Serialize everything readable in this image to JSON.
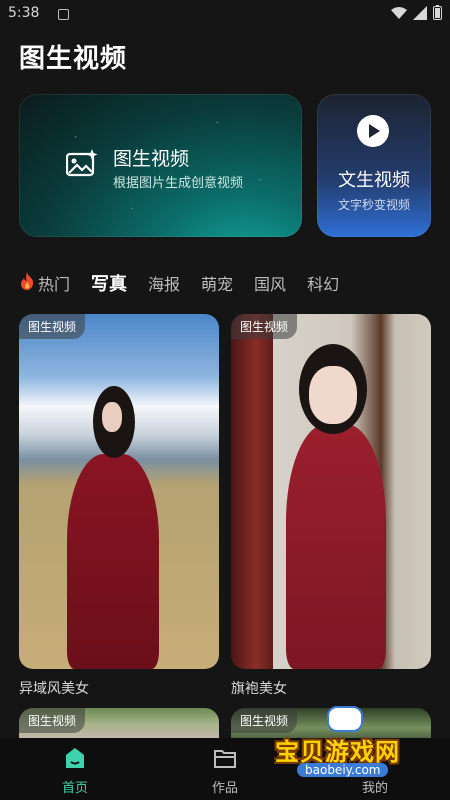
{
  "status_bar": {
    "time": "5:38"
  },
  "page_title": "图生视频",
  "card_main": {
    "title": "图生视频",
    "subtitle": "根据图片生成创意视频",
    "icon": "image-sparkle-icon"
  },
  "card_side": {
    "title": "文生视频",
    "subtitle": "文字秒变视频",
    "icon": "play-icon"
  },
  "tabs": [
    {
      "label": "热门",
      "icon": "flame-icon"
    },
    {
      "label": "写真",
      "active": true
    },
    {
      "label": "海报"
    },
    {
      "label": "萌宠"
    },
    {
      "label": "国风"
    },
    {
      "label": "科幻"
    }
  ],
  "tiles": [
    {
      "tag": "图生视频",
      "caption": "异域风美女"
    },
    {
      "tag": "图生视频",
      "caption": "旗袍美女"
    },
    {
      "tag": "图生视频"
    },
    {
      "tag": "图生视频"
    }
  ],
  "bottom_nav": [
    {
      "label": "首页",
      "icon": "home-icon",
      "active": true
    },
    {
      "label": "作品",
      "icon": "folder-icon"
    },
    {
      "label": "我的",
      "icon": "profile-icon"
    }
  ],
  "colors": {
    "accent": "#3fd3ad",
    "background": "#151515"
  },
  "watermark": {
    "text": "宝贝游戏网",
    "url": "baobeiy.com"
  }
}
